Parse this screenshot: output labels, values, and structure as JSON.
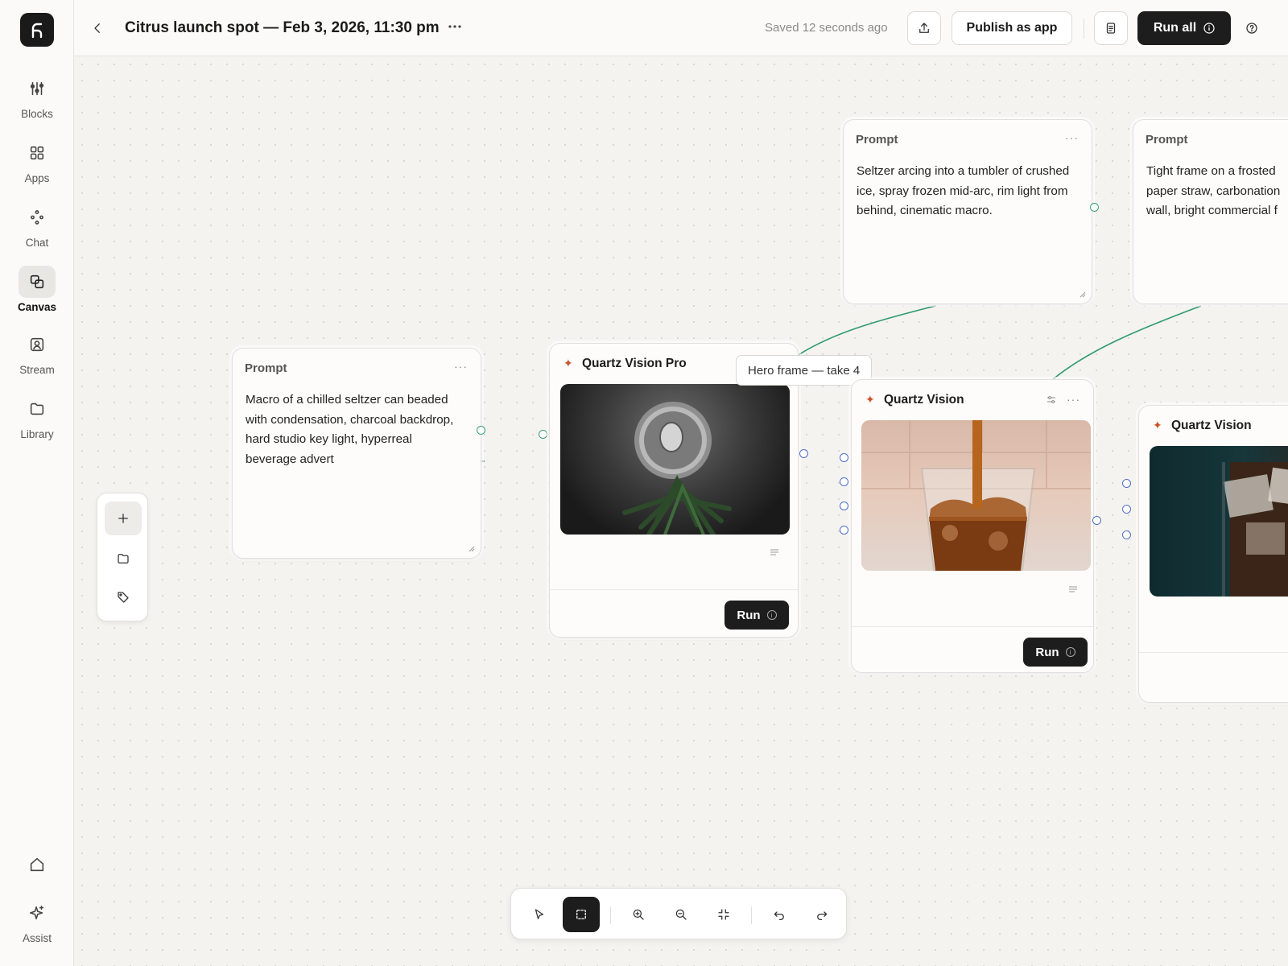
{
  "sidebar": {
    "items": [
      {
        "label": "Blocks",
        "icon": "sliders-icon"
      },
      {
        "label": "Apps",
        "icon": "grid-icon"
      },
      {
        "label": "Chat",
        "icon": "nodes-icon"
      },
      {
        "label": "Canvas",
        "icon": "layers-icon",
        "active": true
      },
      {
        "label": "Stream",
        "icon": "portrait-icon"
      },
      {
        "label": "Library",
        "icon": "folder-icon"
      }
    ],
    "assist_label": "Assist"
  },
  "header": {
    "title": "Citrus launch spot — Feb 3, 2026, 11:30 pm",
    "saved_status": "Saved 12 seconds ago",
    "publish_label": "Publish as app",
    "run_all_label": "Run all"
  },
  "nodes": {
    "prompt_1": {
      "title": "Prompt",
      "text": "Macro of a chilled seltzer can beaded with condensation, charcoal backdrop, hard studio key light, hyperreal beverage advert"
    },
    "prompt_2": {
      "title": "Prompt",
      "text": "Seltzer arcing into a tumbler of crushed ice, spray frozen mid-arc, rim light from behind, cinematic macro."
    },
    "prompt_3": {
      "title": "Prompt",
      "text": "Tight frame on a frosted paper straw, carbonation wall, bright commercial f"
    },
    "model_1": {
      "title": "Quartz Vision Pro",
      "run_label": "Run"
    },
    "model_2": {
      "title": "Quartz Vision",
      "run_label": "Run"
    },
    "model_3": {
      "title": "Quartz Vision"
    }
  },
  "tooltip": "Hero frame — take 4",
  "colors": {
    "accent_dark": "#1d1d1d",
    "wire_green": "#2f9a72",
    "port_blue": "#4f6fc9",
    "spark_orange": "#c9542a"
  }
}
